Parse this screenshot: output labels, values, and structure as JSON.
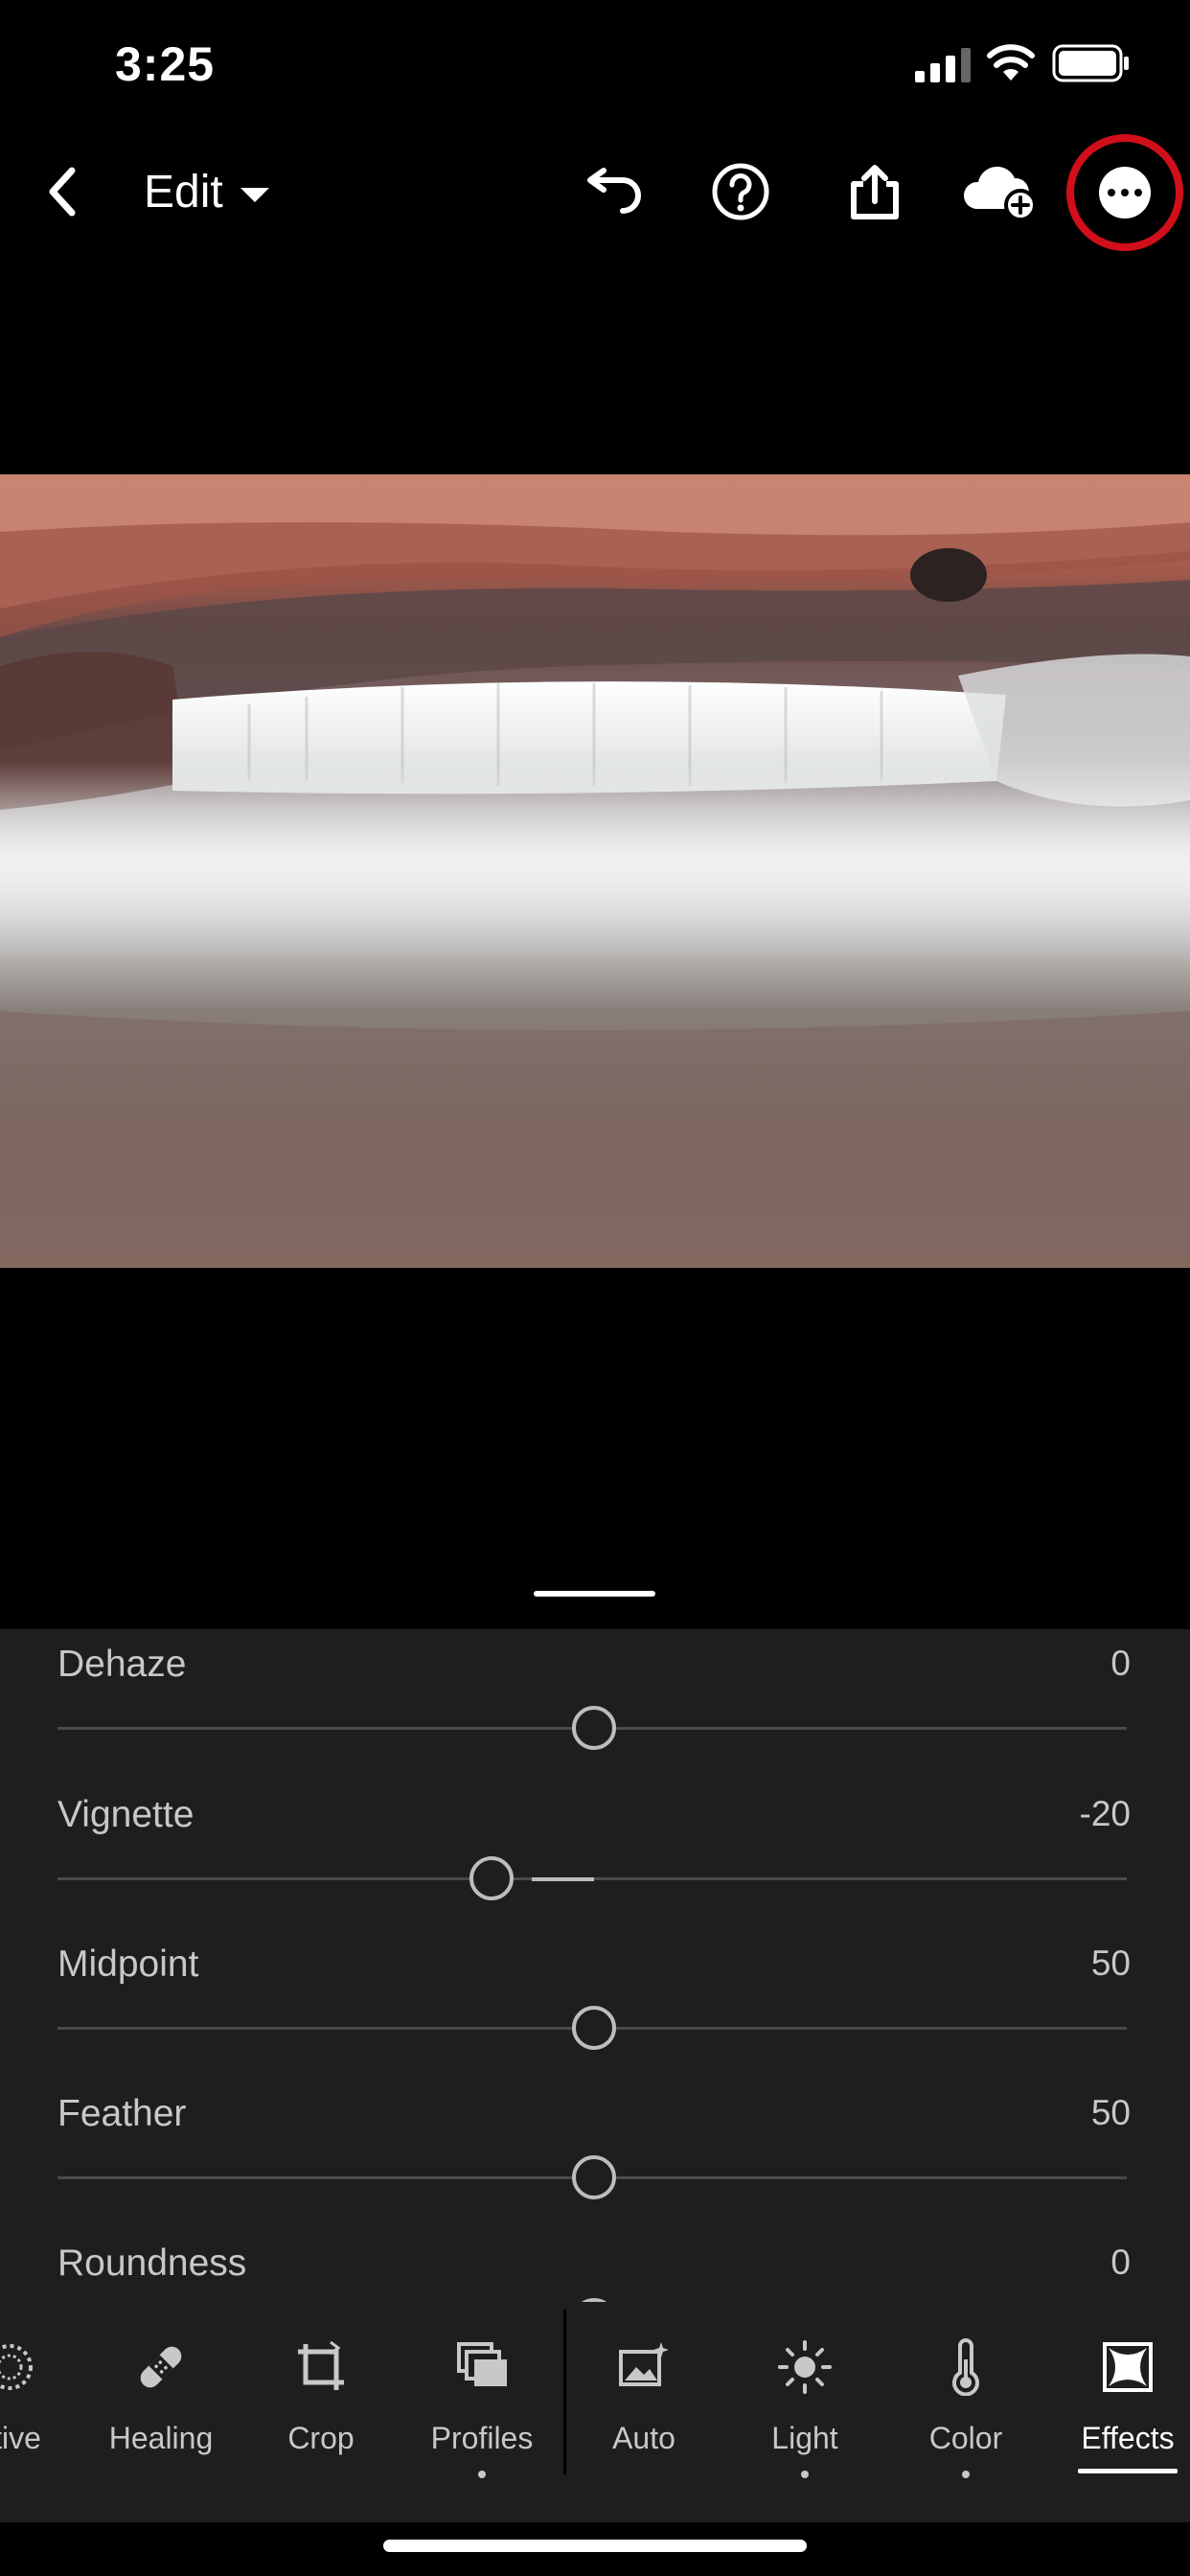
{
  "status_bar": {
    "time": "3:25"
  },
  "top_bar": {
    "edit_label": "Edit"
  },
  "panel": {
    "sliders": [
      {
        "label": "Dehaze",
        "value": "0",
        "level": 0
      },
      {
        "label": "Vignette",
        "value": "-20",
        "level": -20
      },
      {
        "label": "Midpoint",
        "value": "50",
        "level": 50
      },
      {
        "label": "Feather",
        "value": "50",
        "level": 50
      },
      {
        "label": "Roundness",
        "value": "0",
        "level": 0
      }
    ]
  },
  "tools": [
    {
      "label": "ctive",
      "icon": "selective-icon"
    },
    {
      "label": "Healing",
      "icon": "bandage-icon"
    },
    {
      "label": "Crop",
      "icon": "crop-icon"
    },
    {
      "label": "Profiles",
      "icon": "profiles-icon"
    },
    {
      "label": "Auto",
      "icon": "auto-icon"
    },
    {
      "label": "Light",
      "icon": "sun-icon"
    },
    {
      "label": "Color",
      "icon": "thermometer-icon"
    },
    {
      "label": "Effects",
      "icon": "effects-icon"
    }
  ],
  "colors": {
    "accent_highlight": "#d10f1a",
    "panel_bg": "#1e1e1e"
  }
}
